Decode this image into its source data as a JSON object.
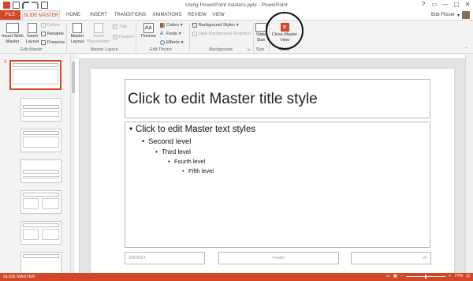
{
  "window": {
    "title": "Using PowerPoint masters.pptx - PowerPoint",
    "controls": [
      "?",
      "▭",
      "—",
      "▢",
      "✕"
    ]
  },
  "tabs": {
    "file": "FILE",
    "items": [
      "SLIDE MASTER",
      "HOME",
      "INSERT",
      "TRANSITIONS",
      "ANIMATIONS",
      "REVIEW",
      "VIEW"
    ],
    "active": "SLIDE MASTER"
  },
  "user": {
    "name": "Bob Flisser"
  },
  "ribbon": {
    "edit_master": {
      "insert_slide_master": "Insert Slide Master",
      "insert_layout": "Insert Layout",
      "delete": "Delete",
      "rename": "Rename",
      "preserve": "Preserve",
      "group": "Edit Master"
    },
    "master_layout": {
      "master_layout": "Master Layout",
      "insert_placeholder": "Insert Placeholder",
      "title": "Title",
      "footers": "Footers",
      "group": "Master Layout"
    },
    "edit_theme": {
      "themes": "Themes",
      "colors": "Colors",
      "fonts": "Fonts",
      "effects": "Effects",
      "group": "Edit Theme"
    },
    "background": {
      "background_styles": "Background Styles",
      "hide_background_graphics": "Hide Background Graphics",
      "group": "Background"
    },
    "size": {
      "slide_size": "Slide Size",
      "group": "Size"
    },
    "close": {
      "close_master_view": "Close Master View",
      "group": "Close"
    }
  },
  "slide": {
    "title": "Click to edit Master title style",
    "levels": [
      "Click to edit Master text styles",
      "Second level",
      "Third level",
      "Fourth level",
      "Fifth level"
    ],
    "date": "3/4/2014",
    "footer": "Footer",
    "number": "‹#›"
  },
  "thumbnails": {
    "first_number": "1"
  },
  "status": {
    "view": "SLIDE MASTER",
    "zoom": "77%"
  },
  "colors": {
    "accent": "#d24726",
    "close_icon": "#d24726"
  }
}
